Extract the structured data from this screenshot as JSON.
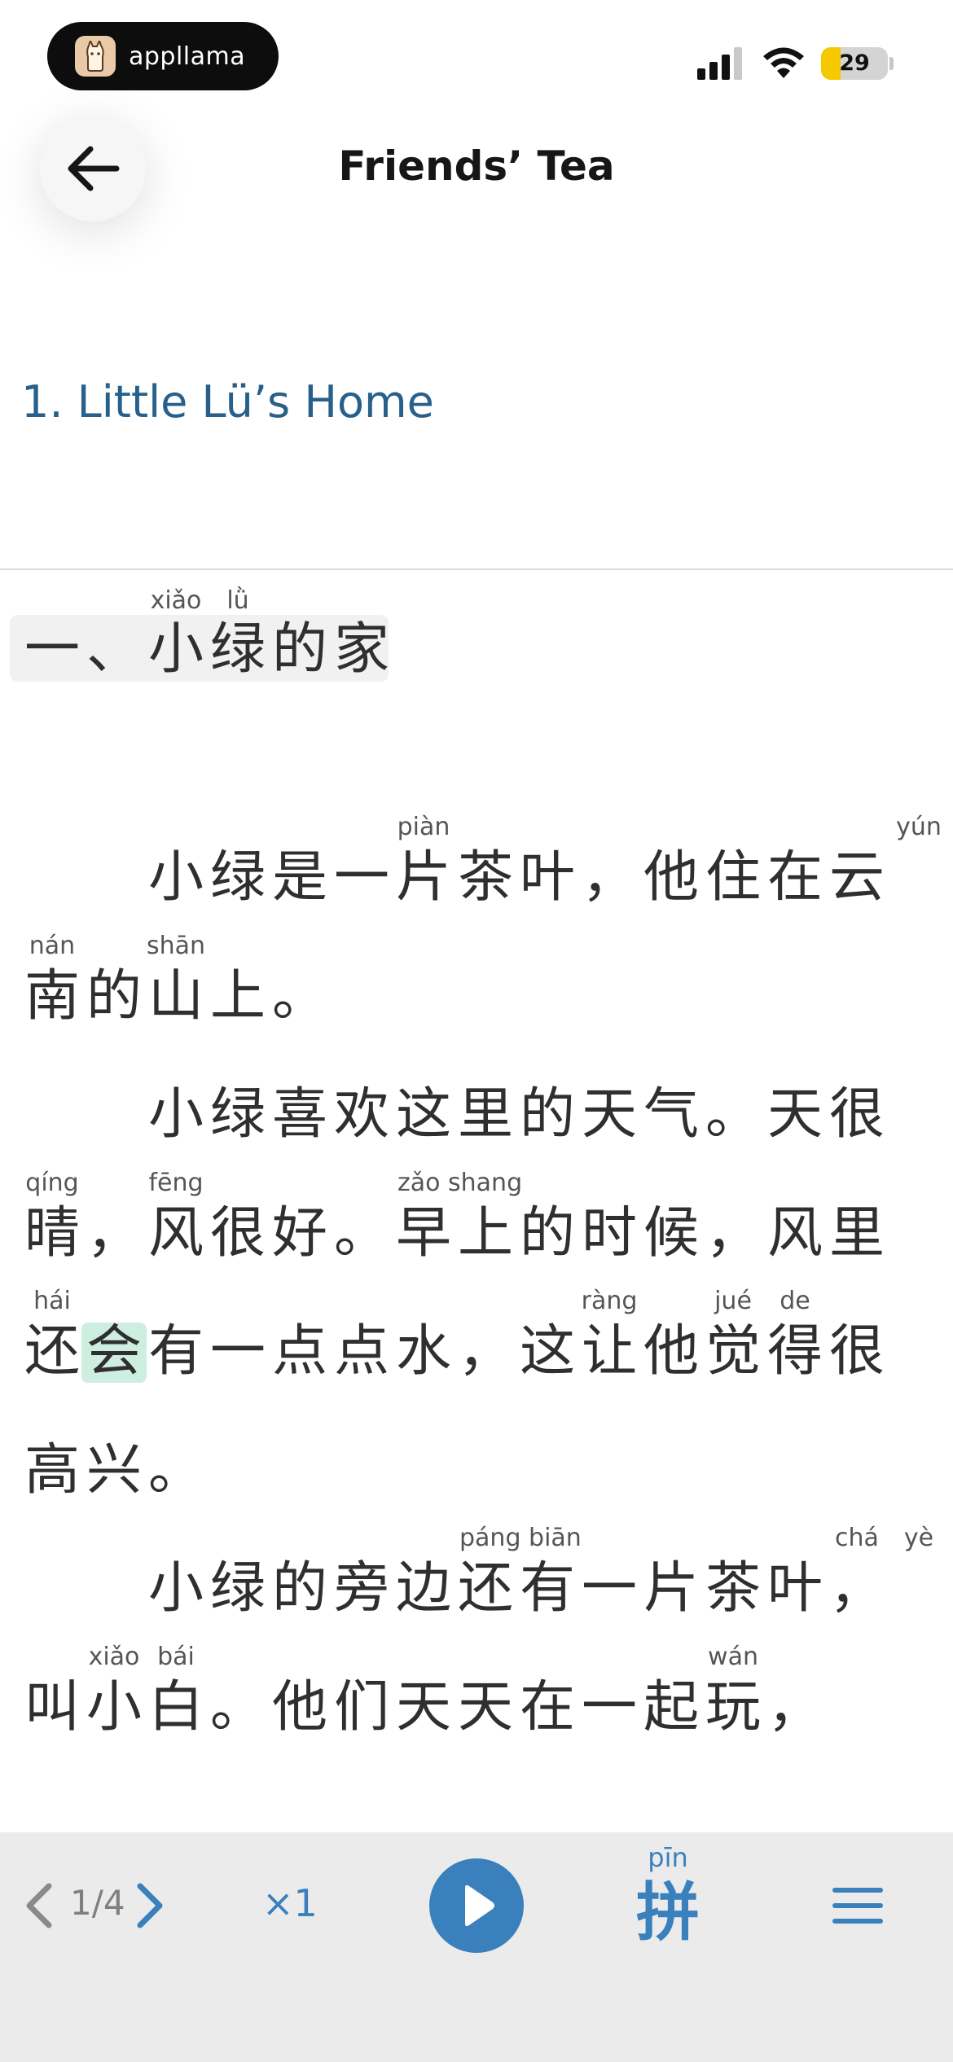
{
  "status_bar": {
    "brand_name": "appllama",
    "battery_level": 29,
    "battery_label": "29",
    "battery_color": "#f4c900"
  },
  "header": {
    "back_icon": "arrow-left-icon",
    "title": "Friends’ Tea"
  },
  "chapter": {
    "title": "1. Little Lü’s Home"
  },
  "reading": {
    "heading_chars": "一、小绿的家",
    "heading_pinyin": [
      "xiǎo",
      "lǜ"
    ],
    "lines": [
      "小绿是一片茶叶，他住在云",
      "南的山上。",
      "小绿喜欢这里的天气。天很",
      "晴，风很好。早上的时候，风里",
      "还会有一点点水，这让他觉得很",
      "高兴。",
      "小绿的旁边还有一片茶叶，",
      "叫小白。他们天天在一起玩，"
    ],
    "pinyin": [
      [
        "piàn",
        "yún"
      ],
      [
        "nán",
        "shān"
      ],
      [],
      [
        "qíng",
        "fēng",
        "zǎo shang"
      ],
      [
        "hái",
        "ràng",
        "jué",
        "de"
      ],
      [],
      [
        "páng biān",
        "chá",
        "yè"
      ],
      [
        "xiǎo",
        "bái",
        "wán"
      ]
    ],
    "highlight_color": "#cdeee0"
  },
  "toolbar": {
    "prev_icon": "chevron-left-icon",
    "page": "1/4",
    "next_icon": "chevron-right-icon",
    "speed": "×1",
    "play_icon": "play-icon",
    "pinyin_label": "pīn",
    "pinyin_char": "拼",
    "menu_icon": "menu-icon",
    "accent": "#3a80bd"
  }
}
